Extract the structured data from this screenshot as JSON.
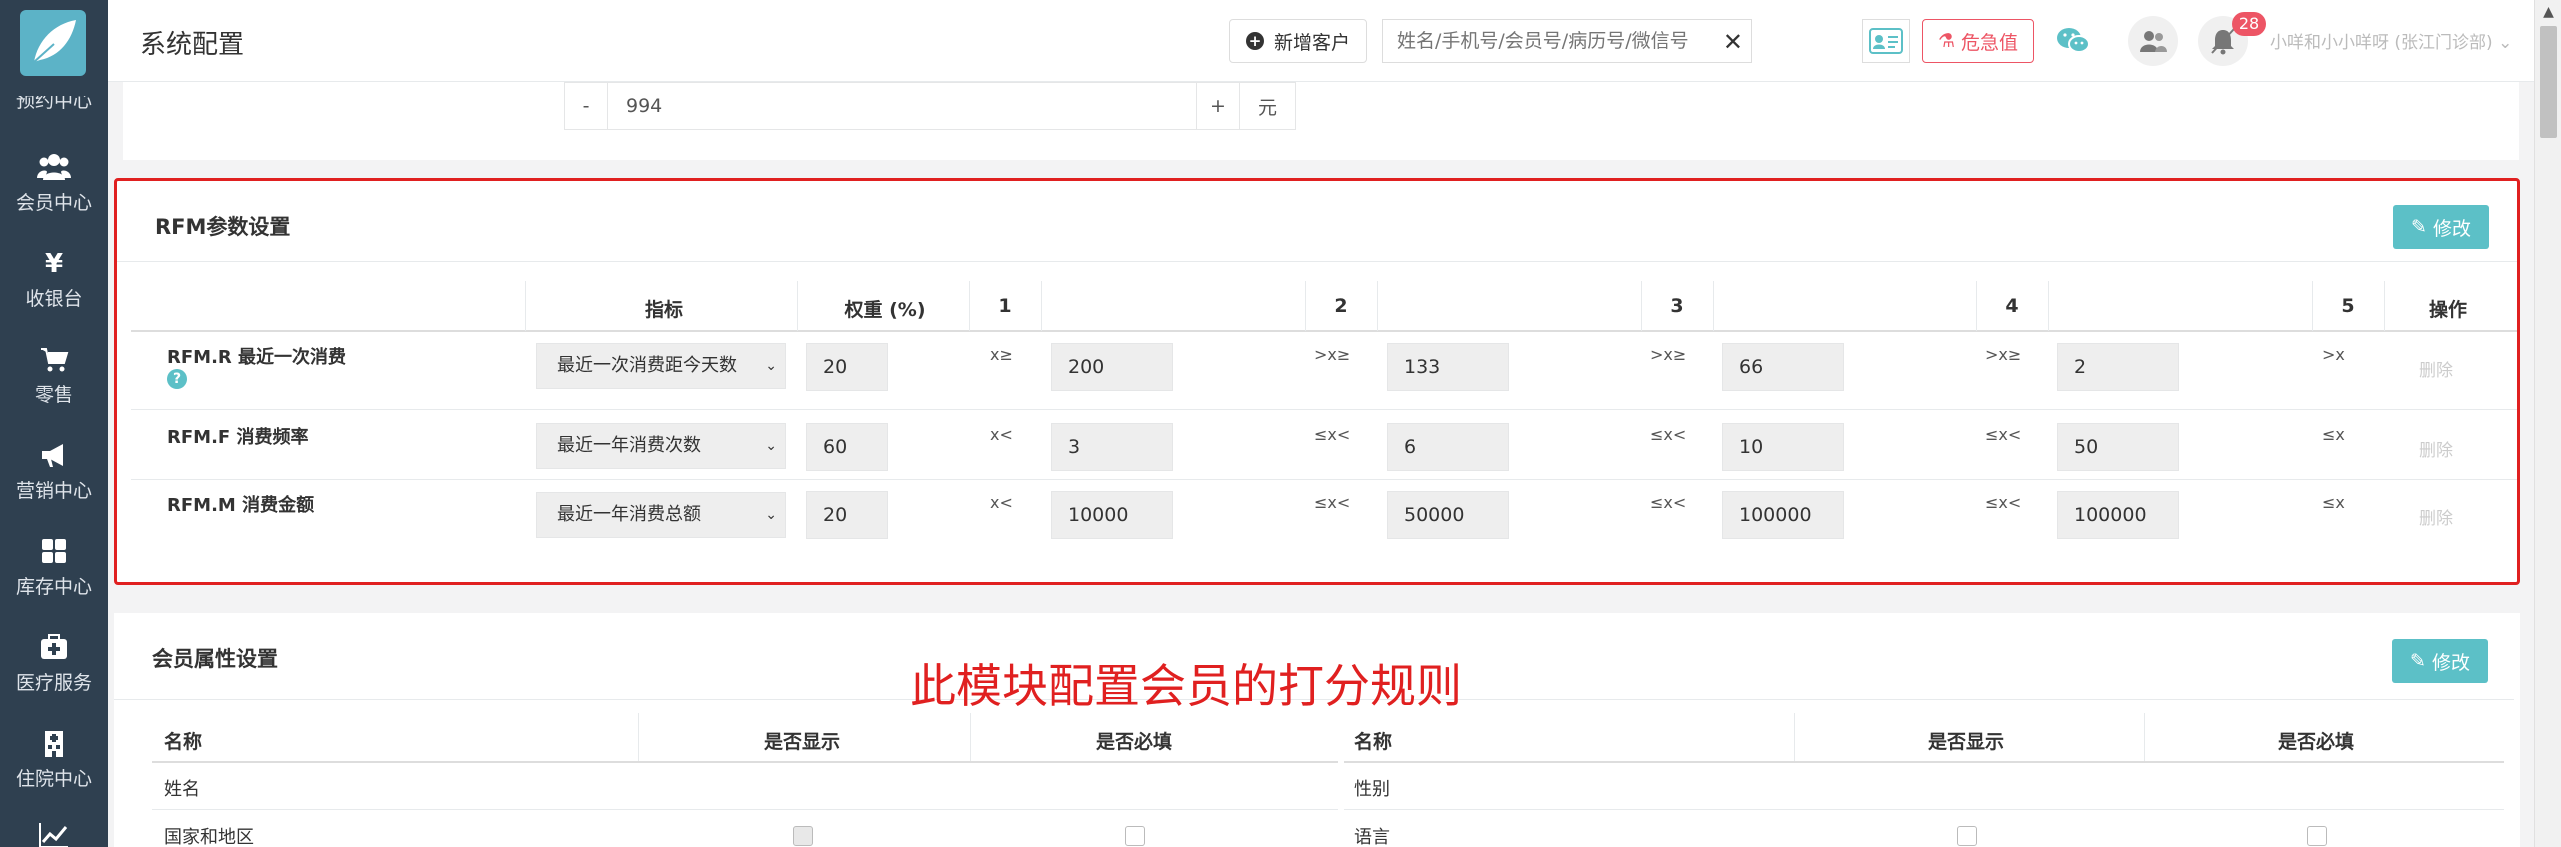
{
  "sidebar": {
    "items": [
      {
        "label": "预约中心",
        "icon": "calendar-icon"
      },
      {
        "label": "会员中心",
        "icon": "users-icon"
      },
      {
        "label": "收银台",
        "icon": "yen-icon"
      },
      {
        "label": "零售",
        "icon": "cart-icon"
      },
      {
        "label": "营销中心",
        "icon": "megaphone-icon"
      },
      {
        "label": "库存中心",
        "icon": "grid-icon"
      },
      {
        "label": "医疗服务",
        "icon": "medkit-icon"
      },
      {
        "label": "住院中心",
        "icon": "hospital-icon"
      },
      {
        "label": "",
        "icon": "chart-icon"
      }
    ]
  },
  "header": {
    "title": "系统配置",
    "add_customer": "新增客户",
    "search_placeholder": "姓名/手机号/会员号/病历号/微信号",
    "emergency": "危急值",
    "badge_count": "28",
    "user": "小咩和小小咩呀 (张江门诊部)"
  },
  "prev_section": {
    "minus": "-",
    "value": "994",
    "plus": "+",
    "unit": "元"
  },
  "rfm": {
    "title": "RFM参数设置",
    "edit": "修改",
    "headers": {
      "indicator": "指标",
      "weight": "权重 (%)",
      "s1": "1",
      "s2": "2",
      "s3": "3",
      "s4": "4",
      "s5": "5",
      "action": "操作"
    },
    "rows": [
      {
        "label": "RFM.R 最近一次消费",
        "indicator": "最近一次消费距今天数",
        "weight": "20",
        "ops": [
          "x≥",
          ">x≥",
          ">x≥",
          ">x≥",
          ">x"
        ],
        "values": [
          "200",
          "133",
          "66",
          "2"
        ],
        "delete": "删除"
      },
      {
        "label": "RFM.F 消费频率",
        "indicator": "最近一年消费次数",
        "weight": "60",
        "ops": [
          "x<",
          "≤x<",
          "≤x<",
          "≤x<",
          "≤x"
        ],
        "values": [
          "3",
          "6",
          "10",
          "50"
        ],
        "delete": "删除"
      },
      {
        "label": "RFM.M 消费金额",
        "indicator": "最近一年消费总额",
        "weight": "20",
        "ops": [
          "x<",
          "≤x<",
          "≤x<",
          "≤x<",
          "≤x"
        ],
        "values": [
          "10000",
          "50000",
          "100000",
          "100000"
        ],
        "delete": "删除"
      }
    ]
  },
  "annotation": "此模块配置会员的打分规则",
  "member": {
    "title": "会员属性设置",
    "edit": "修改",
    "headers": {
      "name": "名称",
      "show": "是否显示",
      "required": "是否必填"
    },
    "left_rows": [
      "姓名",
      "国家和地区"
    ],
    "right_rows": [
      "性别",
      "语言"
    ]
  },
  "colors": {
    "sidebar": "#2f4050",
    "teal": "#5cc0c7",
    "red": "#e02020",
    "danger": "#ed5565"
  }
}
